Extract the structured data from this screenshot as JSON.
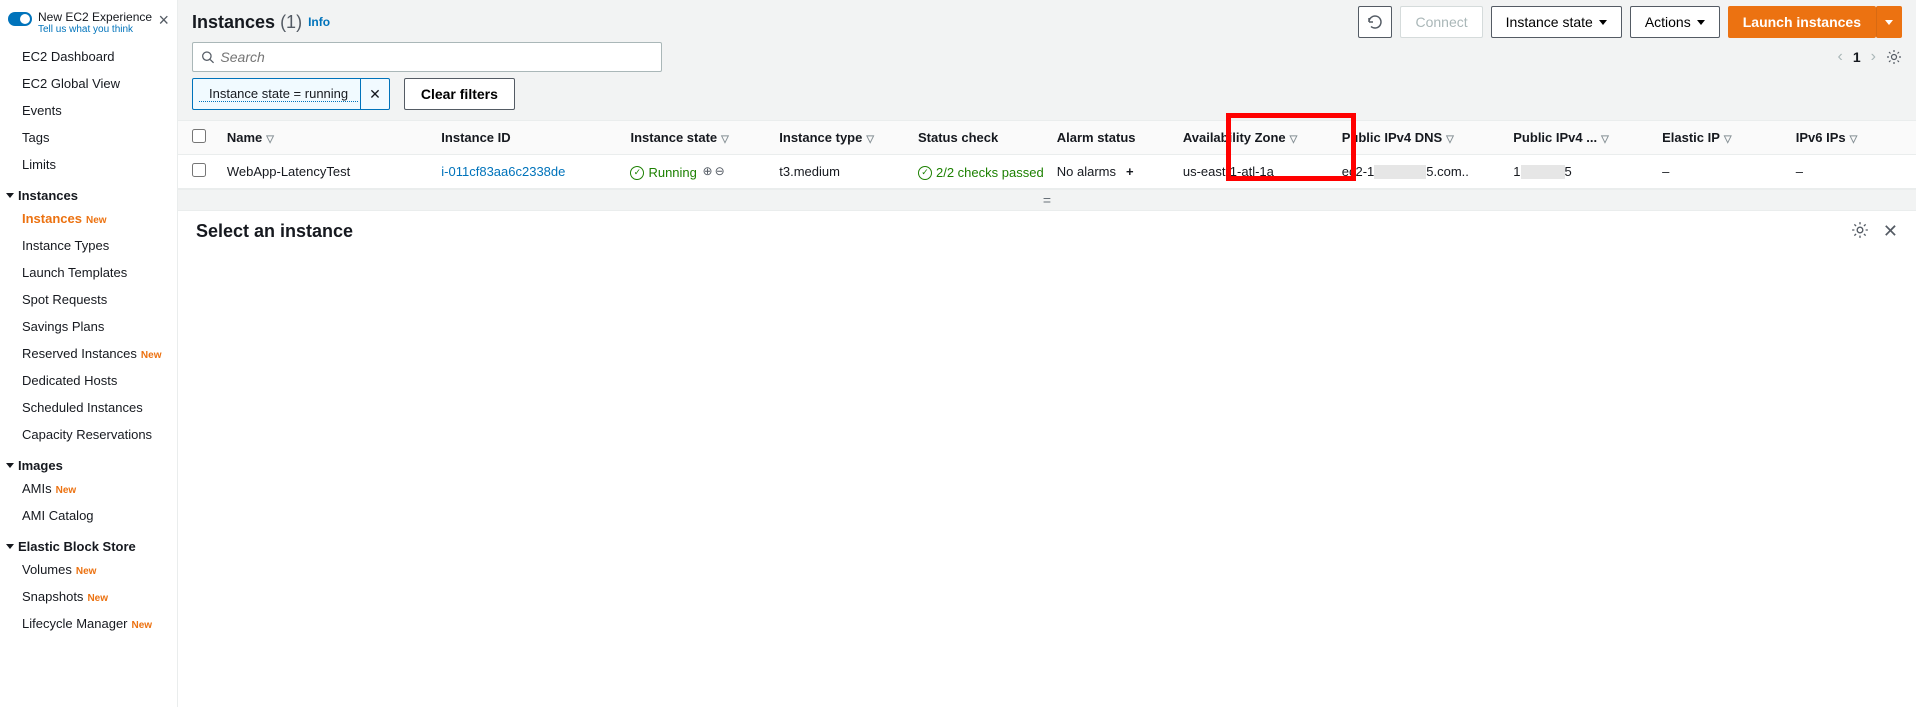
{
  "sidebar": {
    "new_experience": {
      "title": "New EC2 Experience",
      "subtitle": "Tell us what you think"
    },
    "top_items": [
      "EC2 Dashboard",
      "EC2 Global View",
      "Events",
      "Tags",
      "Limits"
    ],
    "groups": [
      {
        "title": "Instances",
        "items": [
          {
            "label": "Instances",
            "new": true,
            "active": true
          },
          {
            "label": "Instance Types"
          },
          {
            "label": "Launch Templates"
          },
          {
            "label": "Spot Requests"
          },
          {
            "label": "Savings Plans"
          },
          {
            "label": "Reserved Instances",
            "new": true
          },
          {
            "label": "Dedicated Hosts"
          },
          {
            "label": "Scheduled Instances"
          },
          {
            "label": "Capacity Reservations"
          }
        ]
      },
      {
        "title": "Images",
        "items": [
          {
            "label": "AMIs",
            "new": true
          },
          {
            "label": "AMI Catalog"
          }
        ]
      },
      {
        "title": "Elastic Block Store",
        "items": [
          {
            "label": "Volumes",
            "new": true
          },
          {
            "label": "Snapshots",
            "new": true
          },
          {
            "label": "Lifecycle Manager",
            "new": true
          }
        ]
      }
    ]
  },
  "header": {
    "title": "Instances",
    "count": "(1)",
    "info": "Info",
    "buttons": {
      "connect": "Connect",
      "instance_state": "Instance state",
      "actions": "Actions",
      "launch": "Launch instances"
    }
  },
  "search": {
    "placeholder": "Search"
  },
  "pager": {
    "page": "1"
  },
  "filter": {
    "chip": "Instance state = running",
    "clear": "Clear filters"
  },
  "table": {
    "columns": [
      "Name",
      "Instance ID",
      "Instance state",
      "Instance type",
      "Status check",
      "Alarm status",
      "Availability Zone",
      "Public IPv4 DNS",
      "Public IPv4 ...",
      "Elastic IP",
      "IPv6 IPs"
    ],
    "row": {
      "name": "WebApp-LatencyTest",
      "instance_id": "i-011cf83aa6c2338de",
      "state": "Running",
      "type": "t3.medium",
      "status_check": "2/2 checks passed",
      "alarm": "No alarms",
      "az": "us-east-1-atl-1a",
      "dns_prefix": "ec2-1",
      "dns_suffix": "5.com..",
      "ipv4_prefix": "1",
      "ipv4_suffix": "5",
      "elastic_ip": "–",
      "ipv6": "–"
    }
  },
  "detail": {
    "title": "Select an instance"
  }
}
